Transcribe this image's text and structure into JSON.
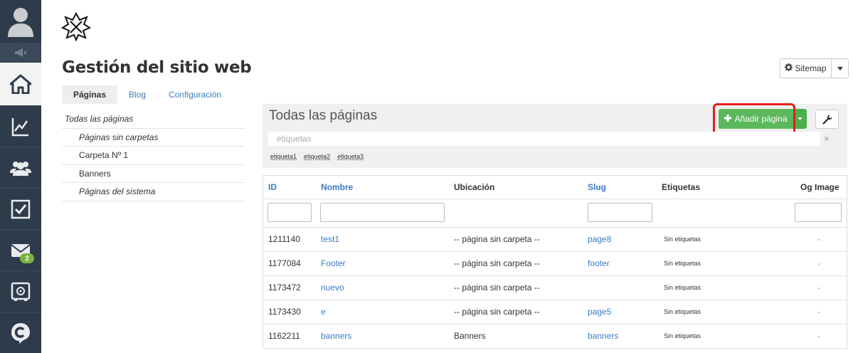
{
  "page_title": "Gestión del sitio web",
  "sitemap": {
    "label": "Sitemap"
  },
  "tabs": [
    "Páginas",
    "Blog",
    "Configuración"
  ],
  "folders": [
    {
      "label": "Todas las páginas",
      "italic": true
    },
    {
      "label": "Páginas sin carpetas",
      "italic": true
    },
    {
      "label": "Carpeta Nº 1",
      "italic": false
    },
    {
      "label": "Banners",
      "italic": false
    },
    {
      "label": "Páginas del sistema",
      "italic": true
    }
  ],
  "main": {
    "title": "Todas las páginas",
    "add_button": "Añadir página",
    "tag_placeholder": "etiquetas",
    "tag_clear": "×",
    "tags": [
      "etiqueta1",
      "etiqueta2",
      "etiqueta3"
    ]
  },
  "table": {
    "columns": [
      "ID",
      "Nombre",
      "Ubicación",
      "Slug",
      "Etiquetas",
      "Og Image"
    ],
    "rows": [
      {
        "id": "1211140",
        "nombre": "test1",
        "ubicacion": "-- página sin carpeta --",
        "slug": "page8",
        "etiquetas": "Sin etiquetas",
        "og": "-"
      },
      {
        "id": "1177084",
        "nombre": "Footer",
        "ubicacion": "-- página sin carpeta --",
        "slug": "footer",
        "etiquetas": "Sin etiquetas",
        "og": "-"
      },
      {
        "id": "1173472",
        "nombre": "nuevo",
        "ubicacion": "-- página sin carpeta --",
        "slug": "",
        "etiquetas": "Sin etiquetas",
        "og": "-"
      },
      {
        "id": "1173430",
        "nombre": "e",
        "ubicacion": "-- página sin carpeta --",
        "slug": "page5",
        "etiquetas": "Sin etiquetas",
        "og": "-"
      },
      {
        "id": "1162211",
        "nombre": "banners",
        "ubicacion": "Banners",
        "slug": "banners",
        "etiquetas": "Sin etiquetas",
        "og": "-"
      }
    ]
  },
  "sidebar_icons": [
    {
      "name": "user-avatar-icon"
    },
    {
      "name": "megaphone-icon"
    },
    {
      "name": "home-icon"
    },
    {
      "name": "analytics-chart-icon"
    },
    {
      "name": "contacts-group-icon"
    },
    {
      "name": "tasks-checkbox-icon"
    },
    {
      "name": "mail-icon",
      "badge": "2"
    },
    {
      "name": "safe-icon"
    },
    {
      "name": "chat-icon"
    }
  ],
  "colors": {
    "sidebar": "#2e3b4b",
    "accent_green": "#5cb85c",
    "link": "#3b7bbf",
    "highlight": "#e0201b"
  }
}
